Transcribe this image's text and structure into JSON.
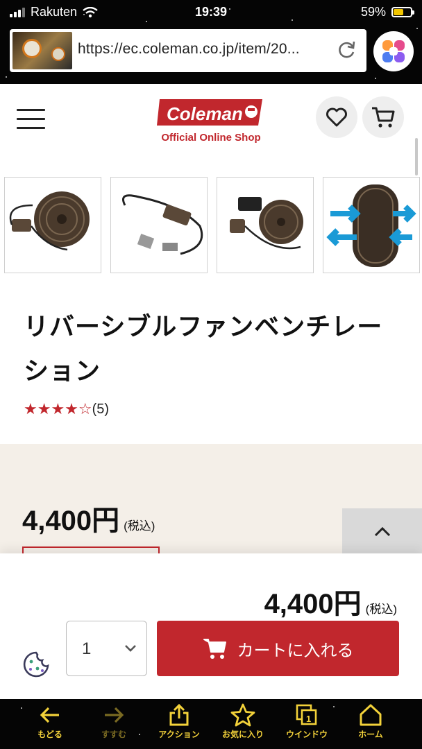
{
  "status_bar": {
    "carrier": "Rakuten",
    "time": "19:39",
    "battery": "59%",
    "battery_level": 0.59
  },
  "browser": {
    "url": "https://ec.coleman.co.jp/item/20..."
  },
  "header": {
    "logo_text": "Coleman",
    "logo_subtitle": "Official Online Shop"
  },
  "product": {
    "title": "リバーシブルファンベンチレーション",
    "rating_stars": "★★★★☆",
    "rating_value": 4,
    "review_count": "(5)",
    "price": "4,400円",
    "tax_note": "(税込)",
    "thumbnails": [
      "fan-with-cable-thumbnail",
      "cable-switch-thumbnail",
      "fan-with-battery-thumbnail",
      "fan-airflow-thumbnail"
    ]
  },
  "cart_bar": {
    "price": "4,400円",
    "tax_note": "(税込)",
    "quantity": "1",
    "add_to_cart_label": "カートに入れる"
  },
  "toolbar": {
    "items": [
      {
        "label": "もどる",
        "icon": "arrow-left-icon"
      },
      {
        "label": "すすむ",
        "icon": "arrow-right-icon"
      },
      {
        "label": "アクション",
        "icon": "share-icon"
      },
      {
        "label": "お気に入り",
        "icon": "star-icon"
      },
      {
        "label": "ウインドウ",
        "icon": "windows-icon"
      },
      {
        "label": "ホーム",
        "icon": "home-icon"
      }
    ],
    "window_count": "1"
  },
  "colors": {
    "brand_red": "#c1272d",
    "toolbar_yellow": "#f3d23a",
    "price_bg": "#f4efe8"
  }
}
